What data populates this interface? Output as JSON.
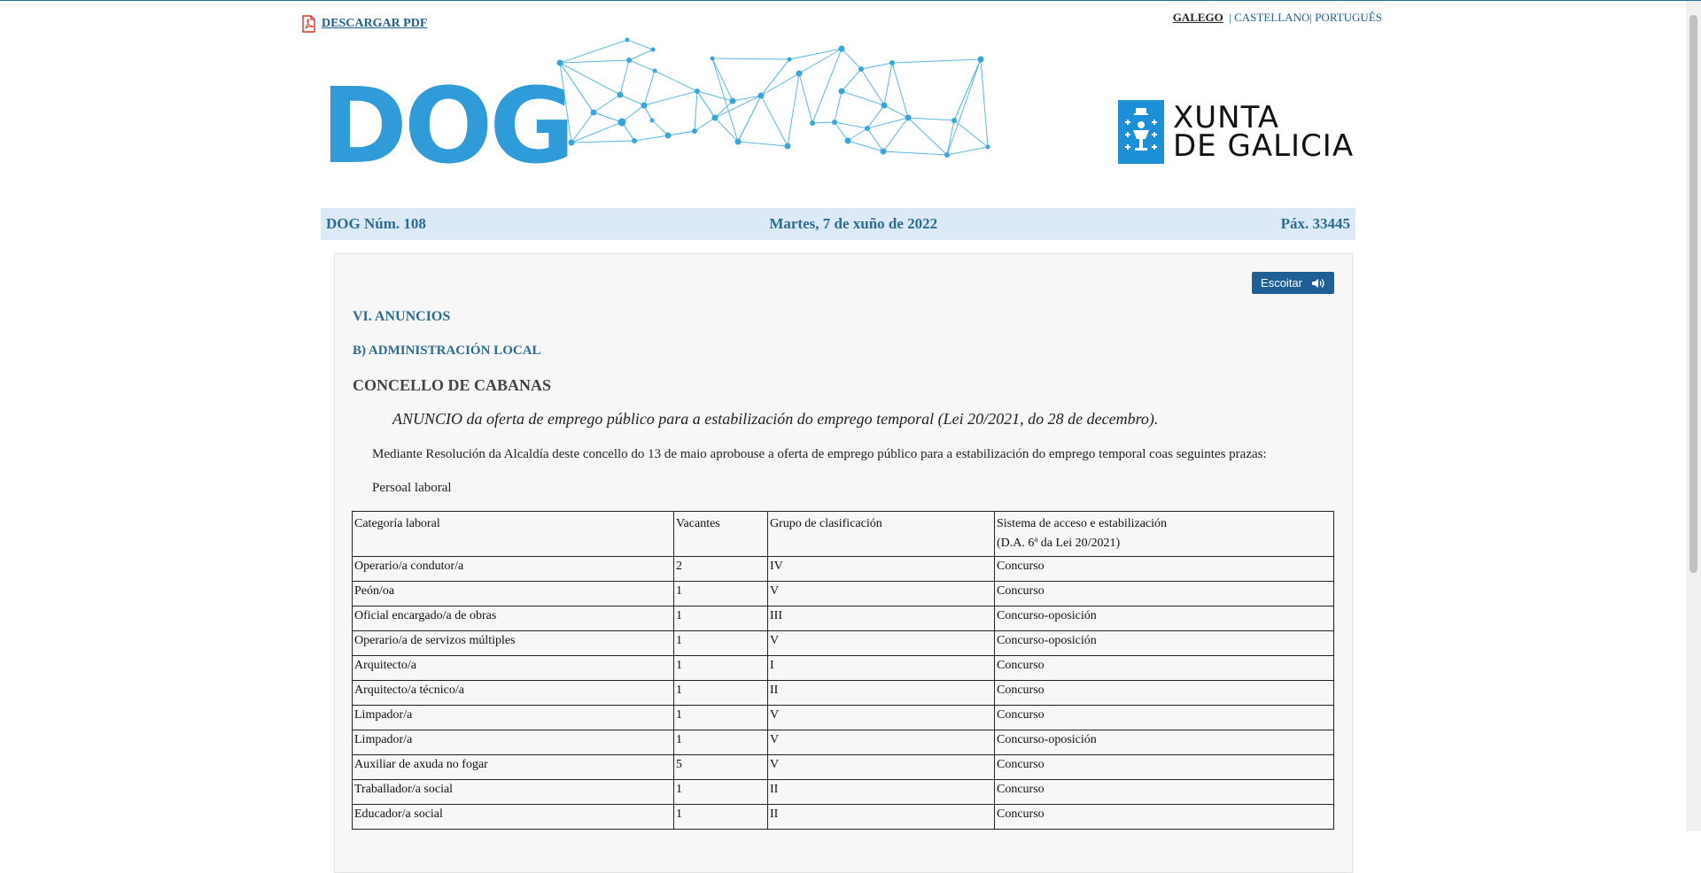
{
  "top": {
    "pdf_label": "DESCARGAR PDF",
    "languages": [
      "GALEGO",
      "CASTELLANO",
      "PORTUGUÊS"
    ],
    "active_language": "GALEGO"
  },
  "banner": {
    "logo_text": "DOG",
    "xunta_line1": "XUNTA",
    "xunta_line2": "DE GALICIA"
  },
  "strip": {
    "number": "DOG Núm. 108",
    "date": "Martes, 7 de xuño de 2022",
    "page": "Páx. 33445"
  },
  "content": {
    "listen_label": "Escoitar",
    "section": "VI. ANUNCIOS",
    "subsection": "B) ADMINISTRACIÓN LOCAL",
    "entity": "CONCELLO DE CABANAS",
    "anuncio_prefix": "ANUNCIO",
    "anuncio_text": " da oferta de emprego público para a estabilización do emprego temporal (Lei 20/2021, do 28 de decembro).",
    "paragraph": "Mediante Resolución da Alcaldía deste concello do 13 de maio aprobouse a oferta de emprego público para a estabilización do emprego temporal coas seguintes prazas:",
    "subtitle": "Persoal laboral",
    "table": {
      "headers": [
        "Categoría laboral",
        "Vacantes",
        "Grupo de clasificación",
        "Sistema de acceso e estabilización",
        "(D.A. 6ª da Lei 20/2021)"
      ],
      "rows": [
        [
          "Operario/a condutor/a",
          "2",
          "IV",
          "Concurso"
        ],
        [
          "Peón/oa",
          "1",
          "V",
          "Concurso"
        ],
        [
          "Oficial encargado/a de obras",
          "1",
          "III",
          "Concurso-oposición"
        ],
        [
          "Operario/a de servizos múltiples",
          "1",
          "V",
          "Concurso-oposición"
        ],
        [
          "Arquitecto/a",
          "1",
          "I",
          "Concurso"
        ],
        [
          "Arquitecto/a técnico/a",
          "1",
          "II",
          "Concurso"
        ],
        [
          "Limpador/a",
          "1",
          "V",
          "Concurso"
        ],
        [
          "Limpador/a",
          "1",
          "V",
          "Concurso-oposición"
        ],
        [
          "Auxiliar de axuda no fogar",
          "5",
          "V",
          "Concurso"
        ],
        [
          "Traballador/a social",
          "1",
          "II",
          "Concurso"
        ],
        [
          "Educador/a social",
          "1",
          "II",
          "Concurso"
        ]
      ]
    }
  }
}
